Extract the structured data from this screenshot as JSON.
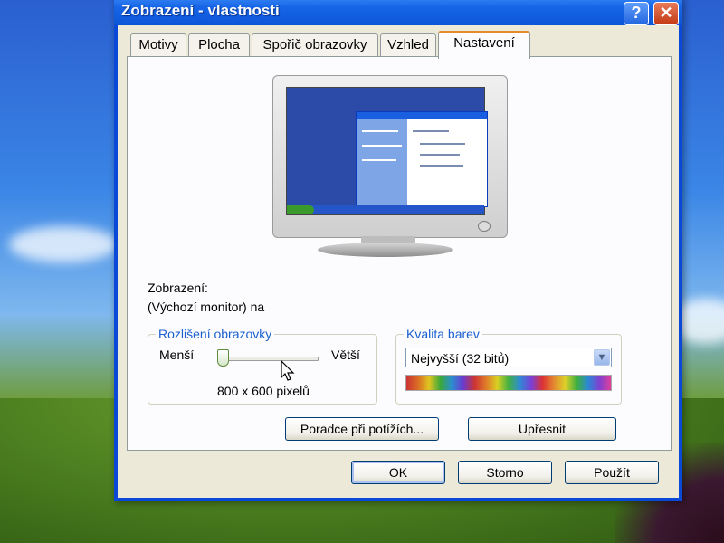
{
  "window": {
    "title": "Zobrazení - vlastnosti",
    "help_label": "?",
    "close_label": "✕"
  },
  "tabs": [
    {
      "label": "Motivy",
      "active": false
    },
    {
      "label": "Plocha",
      "active": false
    },
    {
      "label": "Spořič obrazovky",
      "active": false
    },
    {
      "label": "Vzhled",
      "active": false
    },
    {
      "label": "Nastavení",
      "active": true
    }
  ],
  "display": {
    "label": "Zobrazení:",
    "value": "(Výchozí monitor) na"
  },
  "resolution": {
    "legend": "Rozlišení obrazovky",
    "less_label": "Menší",
    "more_label": "Větší",
    "value_text": "800 x 600 pixelů",
    "slider_position_fraction": 0
  },
  "color_quality": {
    "legend": "Kvalita barev",
    "selected": "Nejvyšší (32 bitů)"
  },
  "buttons": {
    "troubleshoot": "Poradce při potížích...",
    "advanced": "Upřesnit",
    "ok": "OK",
    "cancel": "Storno",
    "apply": "Použít"
  },
  "icons": {
    "cursor": "mouse-pointer-icon",
    "monitor": "monitor-icon",
    "dropdown": "chevron-down-icon"
  },
  "colors": {
    "title_bar": "#1766e8",
    "active_tab_accent": "#e68b2c",
    "legend_text": "#1a5fd0",
    "button_border": "#003c74"
  }
}
